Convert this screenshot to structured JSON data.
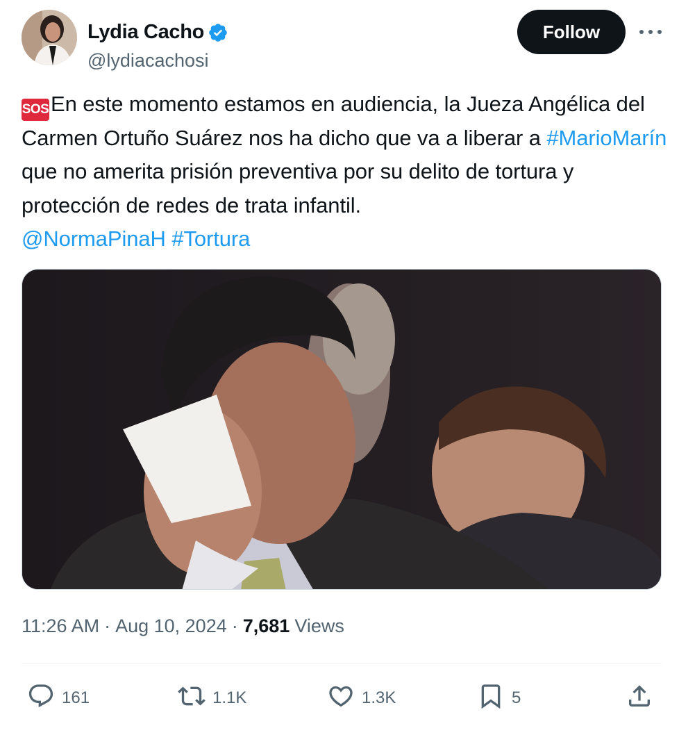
{
  "author": {
    "name": "Lydia Cacho",
    "handle": "@lydiacachosi",
    "verified": true,
    "avatar_icon": "profile-photo"
  },
  "header": {
    "follow_label": "Follow",
    "more_icon": "more-horizontal-icon"
  },
  "tweet": {
    "emoji_label": "SOS",
    "segments": [
      {
        "text": "En este momento estamos en audiencia, la Jueza Angélica del Carmen Ortuño Suárez nos ha dicho que va a liberar a ",
        "link": false
      },
      {
        "text": "#MarioMarín",
        "link": true
      },
      {
        "text": " que no amerita prisión preventiva por su delito de tortura y protección de redes de trata infantil.",
        "link": false
      }
    ],
    "mentions": [
      "@NormaPinaH",
      "#Tortura"
    ]
  },
  "media": {
    "type": "photo"
  },
  "meta": {
    "time": "11:26 AM",
    "date": "Aug 10, 2024",
    "views_count": "7,681",
    "views_label": "Views"
  },
  "actions": {
    "replies": "161",
    "reposts": "1.1K",
    "likes": "1.3K",
    "bookmarks": "5"
  },
  "colors": {
    "link": "#1d9bf0",
    "text": "#0f1419",
    "secondary": "#536471",
    "verified": "#1d9bf0",
    "follow_bg": "#0f1419"
  }
}
